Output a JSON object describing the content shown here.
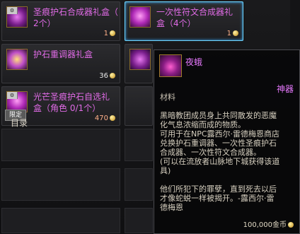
{
  "items": [
    {
      "name_l1": "圣痕护石合成器礼盒（",
      "name_l2": "2个）",
      "count": "1",
      "icon": "gift-box-icon"
    },
    {
      "name_l1": "一次性符文合成器礼",
      "name_l2": "盒（4个）",
      "count": "1",
      "icon": "gift-box-icon"
    },
    {
      "name_l1": "护石重调器礼盒",
      "name_l2": "",
      "count": "36",
      "icon": "gift-box-icon"
    },
    {
      "name_l1": "光芒圣痕护石自选礼",
      "name_l2": "盒（角色 0/1个）",
      "count": "470",
      "limit_label": "限定",
      "icon": "gift-box-icon"
    }
  ],
  "list_label": "目录",
  "tooltip": {
    "title": "夜蛾",
    "rarity": "神器",
    "type": "材料",
    "description": "黑暗教团成员身上共同散发的恶魔\n化气息浓缩而成的物质。\n可用于在NPC露西尔·雷德梅恩商店\n兑换护石重调器、一次性圣痕护石\n合成器、一次性符文合成器。\n(可以在流放者山脉地下城获得该道\n具)",
    "quote": "他们所犯下的罪孽，直到死去以后\n才像蛇蜕一样被揭开。-露西尔·雷\n德梅恩",
    "price": "100,000金币"
  },
  "colors": {
    "rare_purple": "#e879ff",
    "selected_border": "#6fd6ff",
    "price": "#ff7a55"
  }
}
